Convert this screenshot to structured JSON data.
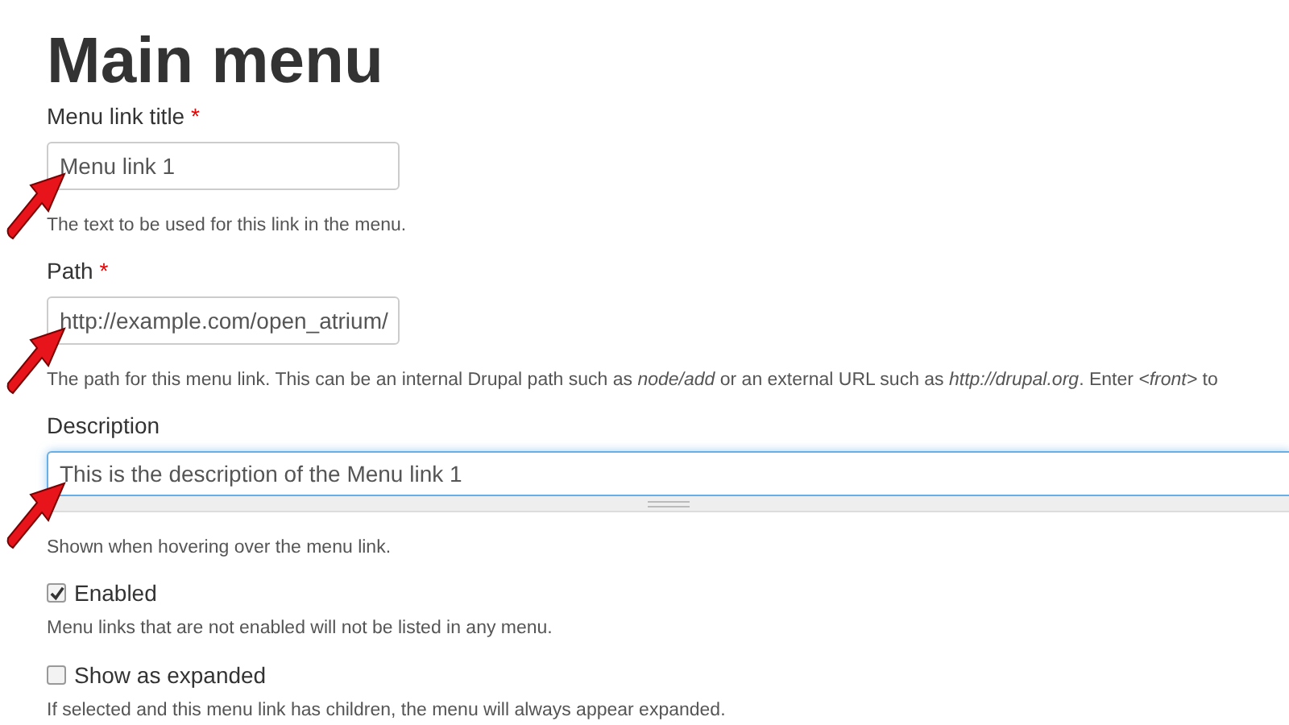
{
  "title": "Main menu",
  "fields": [
    {
      "kind": "input",
      "label": "Menu link title",
      "required_mark": "*",
      "value": "Menu link 1",
      "help": "The text to be used for this link in the menu.",
      "annotated": true,
      "focused": false
    },
    {
      "kind": "input",
      "label": "Path",
      "required_mark": "*",
      "value": "http://example.com/open_atrium/",
      "help": "The path for this menu link. This can be an internal Drupal path such as *node/add* or an external URL such as *http://drupal.org*. Enter *<front>* to",
      "annotated": true,
      "focused": false
    },
    {
      "kind": "textarea",
      "label": "Description",
      "value": "This is the description of the Menu link 1",
      "help": "Shown when hovering over the menu link.",
      "annotated": true,
      "focused": true
    }
  ],
  "checkboxes": [
    {
      "label": "Enabled",
      "checked": true,
      "help": "Menu links that are not enabled will not be listed in any menu."
    },
    {
      "label": "Show as expanded",
      "checked": false,
      "help": "If selected and this menu link has children, the menu will always appear expanded."
    }
  ]
}
